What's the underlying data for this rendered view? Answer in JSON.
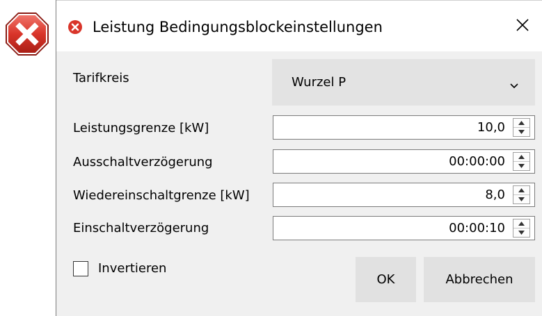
{
  "dialog": {
    "title": "Leistung Bedingungsblockeinstellungen",
    "close_glyph": "✕"
  },
  "form": {
    "tarifkreis": {
      "label": "Tarifkreis",
      "value": "Wurzel P"
    },
    "fields": [
      {
        "label": "Leistungsgrenze [kW]",
        "value": "10,0"
      },
      {
        "label": "Ausschaltverzögerung",
        "value": "00:00:00"
      },
      {
        "label": "Wiedereinschaltgrenze [kW]",
        "value": "8,0"
      },
      {
        "label": "Einschaltverzögerung",
        "value": "00:00:10"
      }
    ],
    "invert": {
      "label": "Invertieren",
      "checked": false
    }
  },
  "buttons": {
    "ok": "OK",
    "cancel": "Abbrechen"
  },
  "icons": {
    "big_error": "error-icon",
    "title_error": "error-icon",
    "close": "close-icon",
    "chevron": "chevron-down-icon"
  },
  "colors": {
    "error_red": "#d9352a",
    "dialog_bg": "#f0f0f0",
    "button_bg": "#e1e1e1"
  }
}
